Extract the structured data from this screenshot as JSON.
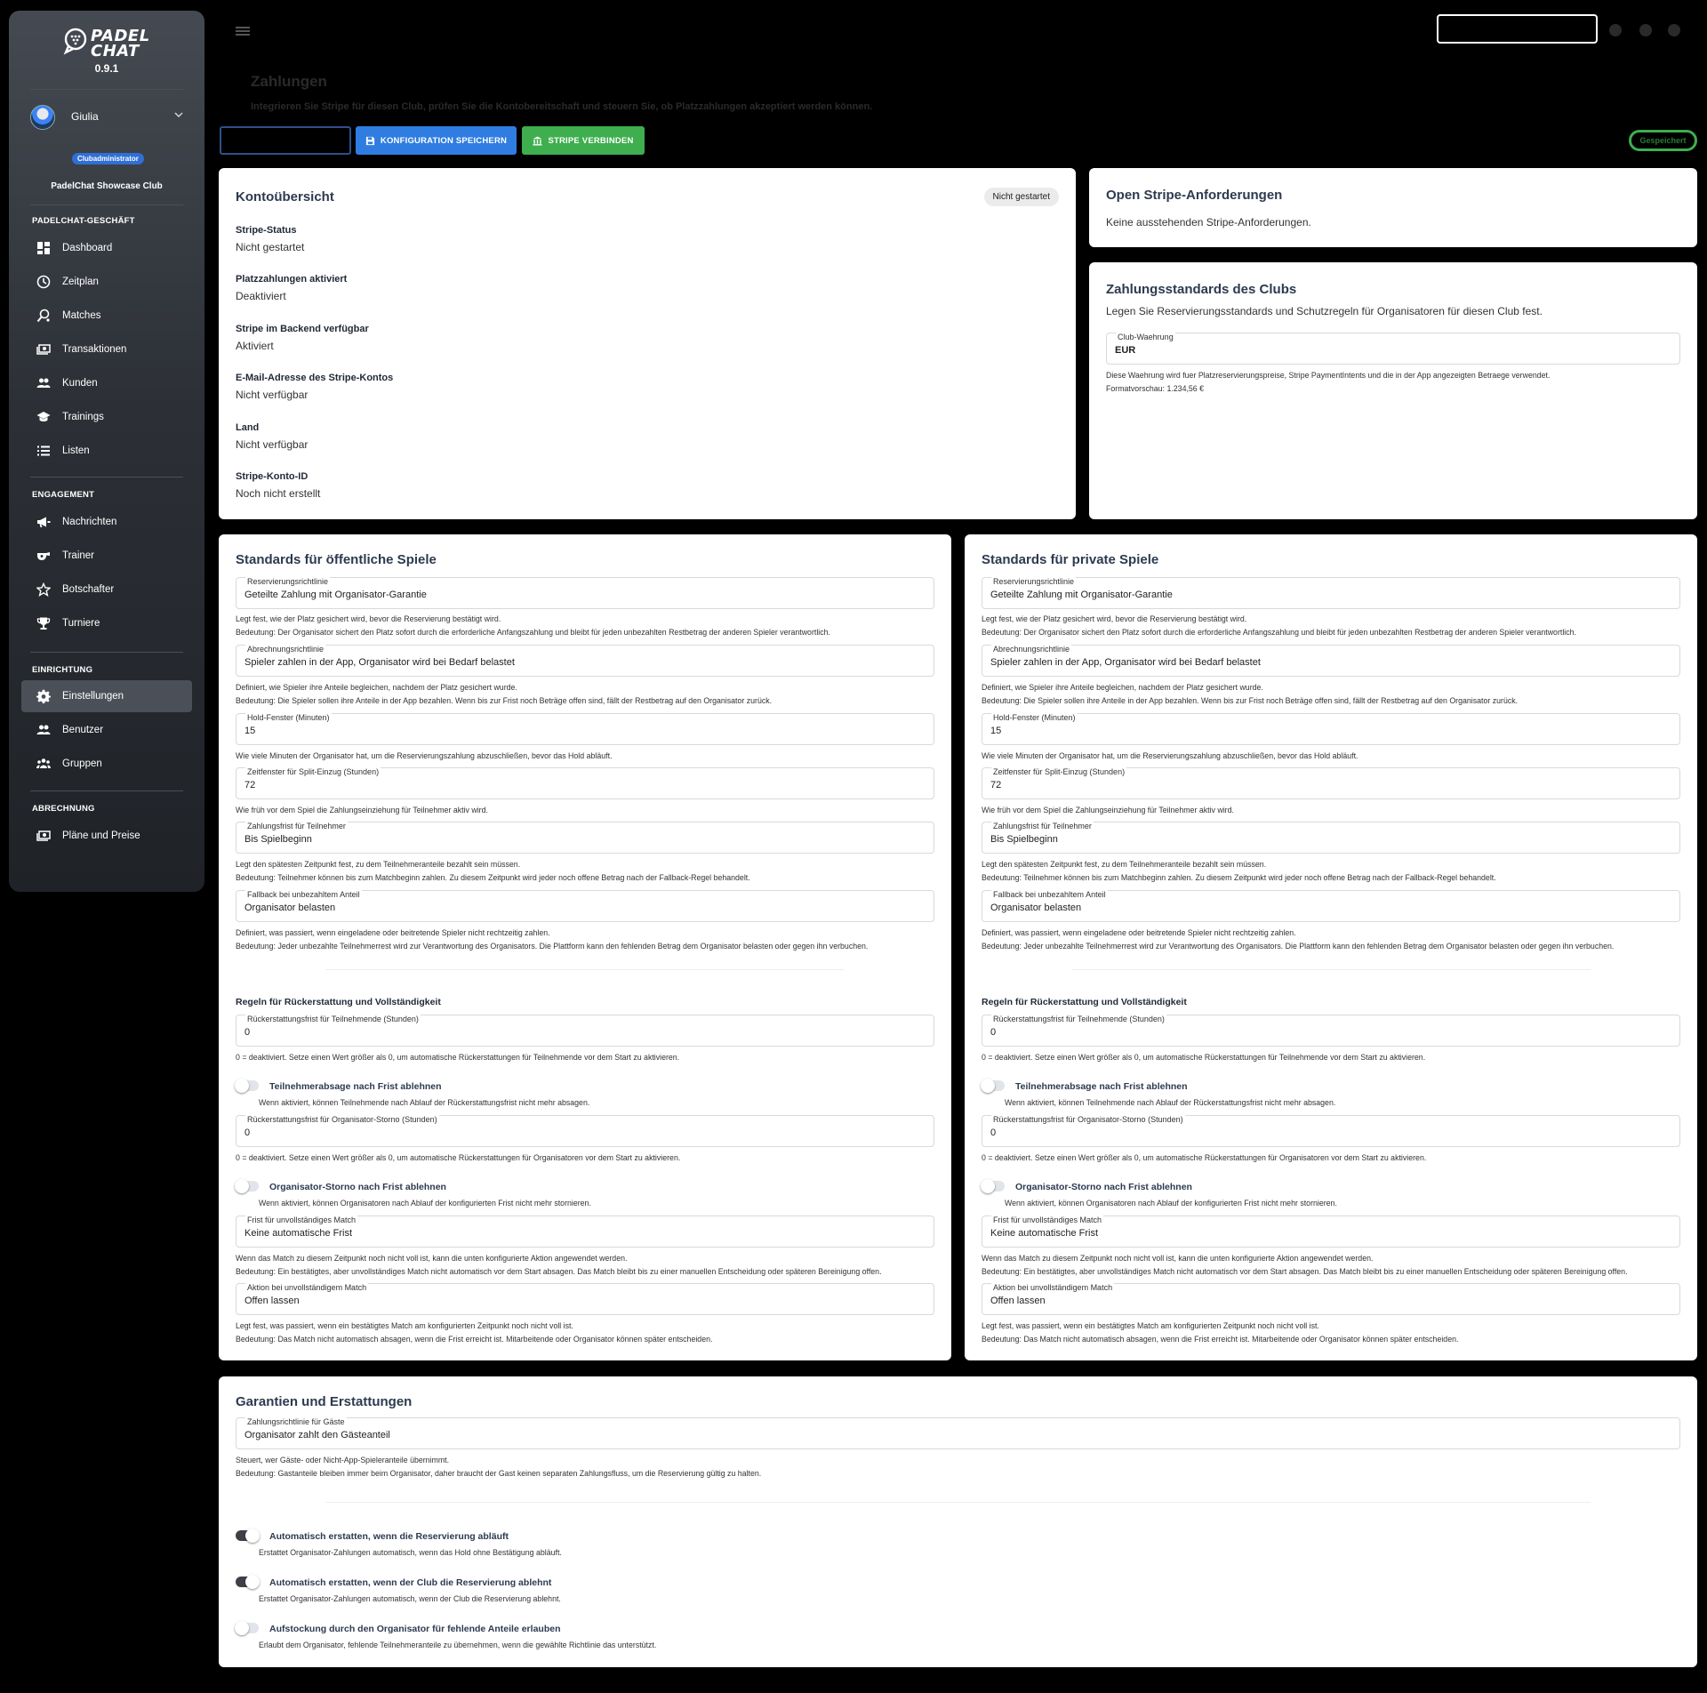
{
  "brand": {
    "logo_text": "PADEL\nCHAT",
    "version": "0.9.1"
  },
  "user": {
    "name": "Giulia",
    "role": "Clubadministrator",
    "club": "PadelChat Showcase Club"
  },
  "sidebar": {
    "sections": [
      {
        "title": "PADELCHAT-GESCHÄFT",
        "items": [
          {
            "label": "Dashboard",
            "icon": "dashboard-icon"
          },
          {
            "label": "Zeitplan",
            "icon": "clock-icon"
          },
          {
            "label": "Matches",
            "icon": "racket-icon"
          },
          {
            "label": "Transaktionen",
            "icon": "money-icon"
          },
          {
            "label": "Kunden",
            "icon": "people-icon"
          },
          {
            "label": "Trainings",
            "icon": "school-icon"
          },
          {
            "label": "Listen",
            "icon": "list-icon"
          }
        ]
      },
      {
        "title": "ENGAGEMENT",
        "items": [
          {
            "label": "Nachrichten",
            "icon": "megaphone-icon"
          },
          {
            "label": "Trainer",
            "icon": "whistle-icon"
          },
          {
            "label": "Botschafter",
            "icon": "star-icon"
          },
          {
            "label": "Turniere",
            "icon": "trophy-icon"
          }
        ]
      },
      {
        "title": "EINRICHTUNG",
        "items": [
          {
            "label": "Einstellungen",
            "icon": "gear-icon",
            "active": true
          },
          {
            "label": "Benutzer",
            "icon": "people-icon"
          },
          {
            "label": "Gruppen",
            "icon": "groups-icon"
          }
        ]
      },
      {
        "title": "ABRECHNUNG",
        "items": [
          {
            "label": "Pläne und Preise",
            "icon": "money-icon"
          }
        ]
      }
    ]
  },
  "header": {
    "title": "Zahlungen",
    "subtitle": "Integrieren Sie Stripe für diesen Club, prüfen Sie die Kontobereitschaft und steuern Sie, ob Platzzahlungen akzeptiert werden können.",
    "buttons": {
      "save": "KONFIGURATION SPEICHERN",
      "connect": "STRIPE VERBINDEN"
    },
    "status_pill": "Gespeichert"
  },
  "account": {
    "title": "Kontoübersicht",
    "chip": "Nicht gestartet",
    "rows": [
      {
        "label": "Stripe-Status",
        "value": "Nicht gestartet"
      },
      {
        "label": "Platzzahlungen aktiviert",
        "value": "Deaktiviert"
      },
      {
        "label": "Stripe im Backend verfügbar",
        "value": "Aktiviert"
      },
      {
        "label": "E-Mail-Adresse des Stripe-Kontos",
        "value": "Nicht verfügbar"
      },
      {
        "label": "Land",
        "value": "Nicht verfügbar"
      },
      {
        "label": "Stripe-Konto-ID",
        "value": "Noch nicht erstellt"
      }
    ]
  },
  "requests": {
    "title": "Open Stripe-Anforderungen",
    "text": "Keine ausstehenden Stripe-Anforderungen."
  },
  "defaults": {
    "title": "Zahlungsstandards des Clubs",
    "text": "Legen Sie Reservierungsstandards und Schutzregeln für Organisatoren für diesen Club fest.",
    "currency_label": "Club-Waehrung",
    "currency_value": "EUR",
    "help1": "Diese Waehrung wird fuer Platzreservierungspreise, Stripe PaymentIntents und die in der App angezeigten Betraege verwendet.",
    "help2": "Formatvorschau: 1.234,56 €"
  },
  "games": {
    "public_title": "Standards für öffentliche Spiele",
    "private_title": "Standards für private Spiele",
    "reservation": {
      "label": "Reservierungsrichtlinie",
      "value": "Geteilte Zahlung mit Organisator-Garantie",
      "help1": "Legt fest, wie der Platz gesichert wird, bevor die Reservierung bestätigt wird.",
      "help2": "Bedeutung: Der Organisator sichert den Platz sofort durch die erforderliche Anfangszahlung und bleibt für jeden unbezahlten Restbetrag der anderen Spieler verantwortlich."
    },
    "billing": {
      "label": "Abrechnungsrichtlinie",
      "value": "Spieler zahlen in der App, Organisator wird bei Bedarf belastet",
      "help1": "Definiert, wie Spieler ihre Anteile begleichen, nachdem der Platz gesichert wurde.",
      "help2": "Bedeutung: Die Spieler sollen ihre Anteile in der App bezahlen. Wenn bis zur Frist noch Beträge offen sind, fällt der Restbetrag auf den Organisator zurück."
    },
    "hold": {
      "label": "Hold-Fenster (Minuten)",
      "value": "15",
      "help1": "Wie viele Minuten der Organisator hat, um die Reservierungszahlung abzuschließen, bevor das Hold abläuft."
    },
    "split": {
      "label": "Zeitfenster für Split-Einzug (Stunden)",
      "value": "72",
      "help1": "Wie früh vor dem Spiel die Zahlungseinziehung für Teilnehmer aktiv wird."
    },
    "deadline": {
      "label": "Zahlungsfrist für Teilnehmer",
      "value": "Bis Spielbeginn",
      "help1": "Legt den spätesten Zeitpunkt fest, zu dem Teilnehmeranteile bezahlt sein müssen.",
      "help2": "Bedeutung: Teilnehmer können bis zum Matchbeginn zahlen. Zu diesem Zeitpunkt wird jeder noch offene Betrag nach der Fallback-Regel behandelt."
    },
    "fallback": {
      "label": "Fallback bei unbezahltem Anteil",
      "value": "Organisator belasten",
      "help1": "Definiert, was passiert, wenn eingeladene oder beitretende Spieler nicht rechtzeitig zahlen.",
      "help2": "Bedeutung: Jeder unbezahlte Teilnehmerrest wird zur Verantwortung des Organisators. Die Plattform kann den fehlenden Betrag dem Organisator belasten oder gegen ihn verbuchen."
    },
    "refund_heading": "Regeln für Rückerstattung und Vollständigkeit",
    "refund_participant": {
      "label": "Rückerstattungsfrist für Teilnehmende (Stunden)",
      "value": "0",
      "help1": "0 = deaktiviert. Setze einen Wert größer als 0, um automatische Rückerstattungen für Teilnehmende vor dem Start zu aktivieren."
    },
    "toggle_participant": {
      "label": "Teilnehmerabsage nach Frist ablehnen",
      "help": "Wenn aktiviert, können Teilnehmende nach Ablauf der Rückerstattungsfrist nicht mehr absagen."
    },
    "refund_organizer": {
      "label": "Rückerstattungsfrist für Organisator-Storno (Stunden)",
      "value": "0",
      "help1": "0 = deaktiviert. Setze einen Wert größer als 0, um automatische Rückerstattungen für Organisatoren vor dem Start zu aktivieren."
    },
    "toggle_organizer": {
      "label": "Organisator-Storno nach Frist ablehnen",
      "help": "Wenn aktiviert, können Organisatoren nach Ablauf der konfigurierten Frist nicht mehr stornieren."
    },
    "incomplete_deadline": {
      "label": "Frist für unvollständiges Match",
      "value": "Keine automatische Frist",
      "help1": "Wenn das Match zu diesem Zeitpunkt noch nicht voll ist, kann die unten konfigurierte Aktion angewendet werden.",
      "help2": "Bedeutung: Ein bestätigtes, aber unvollständiges Match nicht automatisch vor dem Start absagen. Das Match bleibt bis zu einer manuellen Entscheidung oder späteren Bereinigung offen."
    },
    "incomplete_action": {
      "label": "Aktion bei unvollständigem Match",
      "value": "Offen lassen",
      "help1": "Legt fest, was passiert, wenn ein bestätigtes Match am konfigurierten Zeitpunkt noch nicht voll ist.",
      "help2": "Bedeutung: Das Match nicht automatisch absagen, wenn die Frist erreicht ist. Mitarbeitende oder Organisator können später entscheiden."
    }
  },
  "guarantees": {
    "title": "Garantien und Erstattungen",
    "guest": {
      "label": "Zahlungsrichtlinie für Gäste",
      "value": "Organisator zahlt den Gästeanteil",
      "help1": "Steuert, wer Gäste- oder Nicht-App-Spieleranteile übernimmt.",
      "help2": "Bedeutung: Gastanteile bleiben immer beim Organisator, daher braucht der Gast keinen separaten Zahlungsfluss, um die Reservierung gültig zu halten."
    },
    "toggles": [
      {
        "label": "Automatisch erstatten, wenn die Reservierung abläuft",
        "help": "Erstattet Organisator-Zahlungen automatisch, wenn das Hold ohne Bestätigung abläuft.",
        "on": true
      },
      {
        "label": "Automatisch erstatten, wenn der Club die Reservierung ablehnt",
        "help": "Erstattet Organisator-Zahlungen automatisch, wenn der Club die Reservierung ablehnt.",
        "on": true
      },
      {
        "label": "Aufstockung durch den Organisator für fehlende Anteile erlauben",
        "help": "Erlaubt dem Organisator, fehlende Teilnehmeranteile zu übernehmen, wenn die gewählte Richtlinie das unterstützt.",
        "on": false
      }
    ]
  },
  "colors": {
    "primary": "#2f7de1",
    "success": "#3eae4e",
    "heading": "#2d3a4f",
    "sidebar_active": "#4b5058"
  }
}
